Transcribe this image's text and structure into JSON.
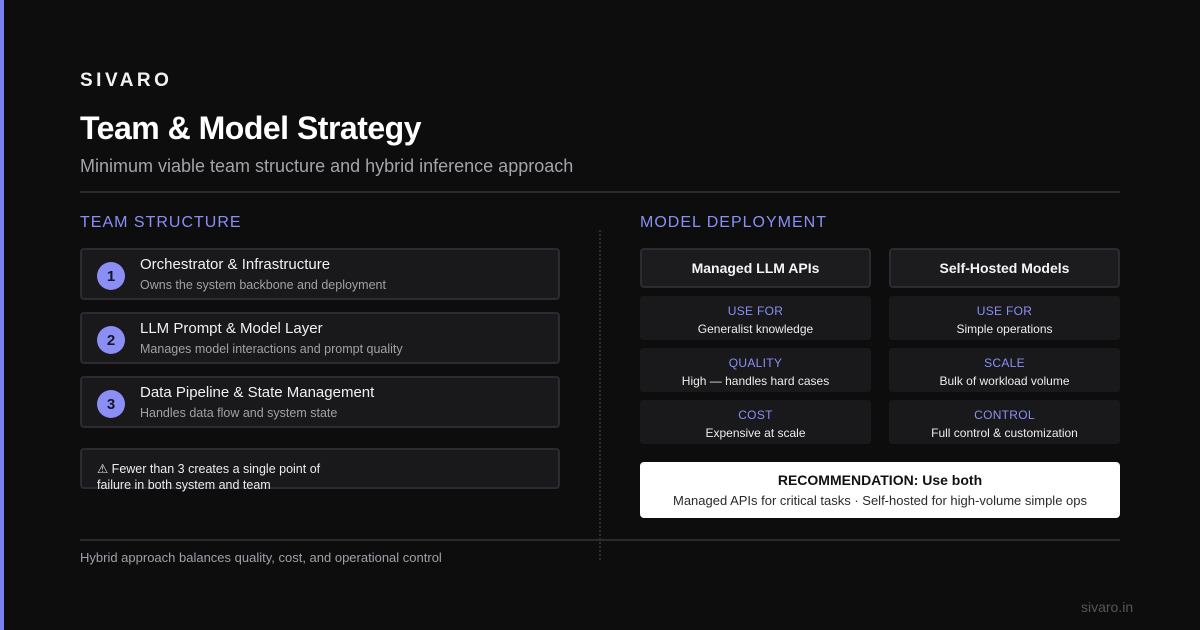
{
  "brand": "SIVARO",
  "title": "Team & Model Strategy",
  "subtitle": "Minimum viable team structure and hybrid inference approach",
  "colors": {
    "accent": "#8b8ff5",
    "background": "#0d0d0e",
    "card": "#19191b"
  },
  "team": {
    "heading": "TEAM STRUCTURE",
    "items": [
      {
        "number": "1",
        "title": "Orchestrator & Infrastructure",
        "description": "Owns the system backbone and deployment"
      },
      {
        "number": "2",
        "title": "LLM Prompt & Model Layer",
        "description": "Manages model interactions and prompt quality"
      },
      {
        "number": "3",
        "title": "Data Pipeline & State Management",
        "description": "Handles data flow and system state"
      }
    ],
    "warning": "⚠ Fewer than 3 creates a single point of failure in both system and team"
  },
  "deployment": {
    "heading": "MODEL DEPLOYMENT",
    "managed": {
      "title": "Managed LLM APIs",
      "rows": [
        {
          "label": "USE FOR",
          "value": "Generalist knowledge"
        },
        {
          "label": "QUALITY",
          "value": "High — handles hard cases"
        },
        {
          "label": "COST",
          "value": "Expensive at scale"
        }
      ]
    },
    "self_hosted": {
      "title": "Self-Hosted Models",
      "rows": [
        {
          "label": "USE FOR",
          "value": "Simple operations"
        },
        {
          "label": "SCALE",
          "value": "Bulk of workload volume"
        },
        {
          "label": "CONTROL",
          "value": "Full control & customization"
        }
      ]
    },
    "recommendation": {
      "title": "RECOMMENDATION: Use both",
      "text": "Managed APIs for critical tasks · Self-hosted for high-volume simple ops"
    }
  },
  "footer": "Hybrid approach balances quality, cost, and operational control",
  "site": "sivaro.in"
}
